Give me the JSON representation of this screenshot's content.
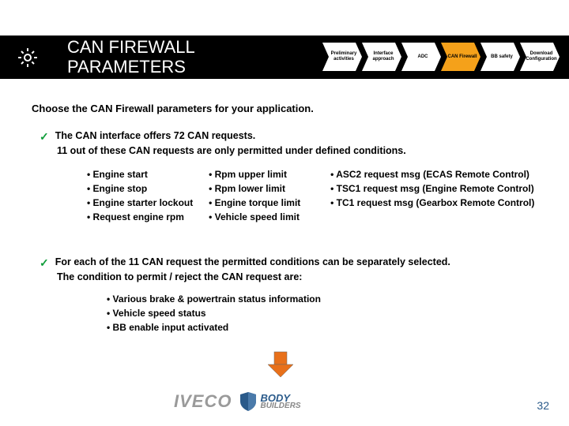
{
  "header": {
    "title_line1": "CAN FIREWALL",
    "title_line2": "PARAMETERS"
  },
  "steps": [
    {
      "label": "Preliminary activities",
      "active": false
    },
    {
      "label": "Interface approach",
      "active": false
    },
    {
      "label": "ADC",
      "active": false
    },
    {
      "label": "CAN Firewall",
      "active": true
    },
    {
      "label": "BB safety",
      "active": false
    },
    {
      "label": "Download Configuration",
      "active": false
    }
  ],
  "intro": "Choose the CAN Firewall parameters for your application.",
  "point1": {
    "line1": "The CAN interface offers 72 CAN requests.",
    "line2": "11 out of these CAN requests are only permitted under defined conditions."
  },
  "columns": {
    "col1": [
      "Engine start",
      "Engine stop",
      "Engine starter lockout",
      "Request engine rpm"
    ],
    "col2": [
      "Rpm upper limit",
      "Rpm lower limit",
      "Engine torque limit",
      "Vehicle speed limit"
    ],
    "col3": [
      "ASC2 request msg (ECAS Remote Control)",
      "TSC1 request msg (Engine Remote Control)",
      "TC1 request msg (Gearbox Remote Control)"
    ]
  },
  "point2": {
    "line1": "For each of the 11 CAN request the permitted conditions can be separately selected.",
    "line2": "The condition to permit / reject the CAN request are:"
  },
  "conditions": [
    "Various brake & powertrain status information",
    "Vehicle speed status",
    "BB enable input activated"
  ],
  "footer": {
    "brand1": "IVECO",
    "brand2a": "BODY",
    "brand2b": "BUILDERS",
    "page": "32"
  }
}
